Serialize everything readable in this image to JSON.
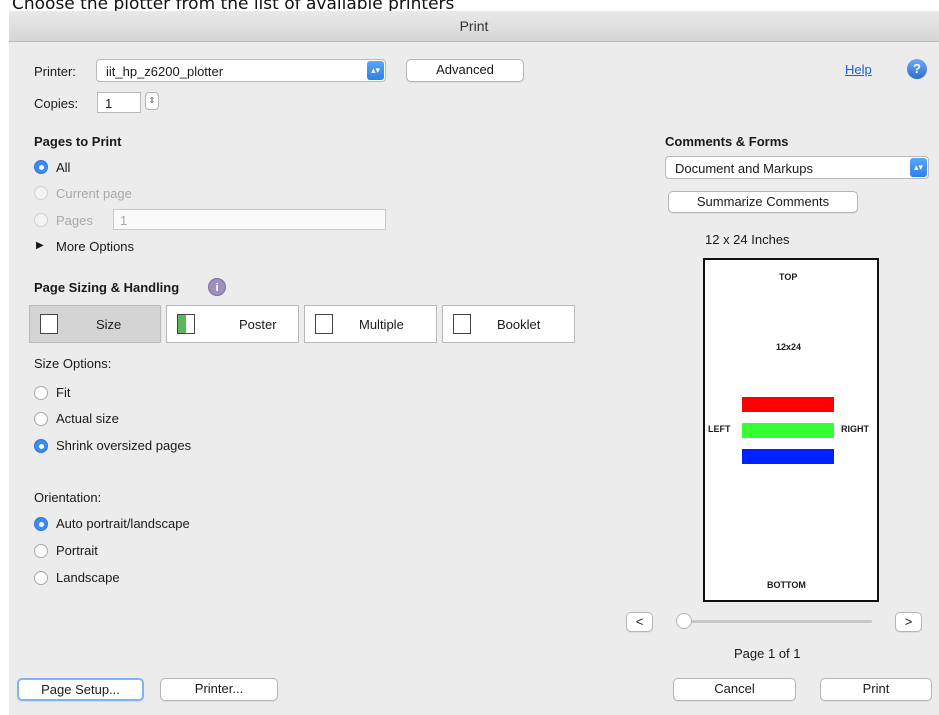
{
  "caption": "Choose the plotter from the list of available printers",
  "window_title": "Print",
  "printer": {
    "label": "Printer:",
    "value": "iit_hp_z6200_plotter",
    "advanced_label": "Advanced"
  },
  "help_label": "Help",
  "copies": {
    "label": "Copies:",
    "value": "1"
  },
  "pages_to_print": {
    "heading": "Pages to Print",
    "all_label": "All",
    "current_label": "Current page",
    "pages_label": "Pages",
    "pages_value": "1",
    "more_options_label": "More Options",
    "selected": "All"
  },
  "page_sizing": {
    "heading": "Page Sizing & Handling",
    "buttons": [
      "Size",
      "Poster",
      "Multiple",
      "Booklet"
    ],
    "selected": "Size"
  },
  "size_options": {
    "heading": "Size Options:",
    "options": [
      "Fit",
      "Actual size",
      "Shrink oversized pages"
    ],
    "selected": "Shrink oversized pages"
  },
  "orientation": {
    "heading": "Orientation:",
    "options": [
      "Auto portrait/landscape",
      "Portrait",
      "Landscape"
    ],
    "selected": "Auto portrait/landscape"
  },
  "comments_forms": {
    "heading": "Comments & Forms",
    "value": "Document and Markups",
    "summarize_label": "Summarize Comments"
  },
  "preview": {
    "size_label": "12 x 24 Inches",
    "top": "TOP",
    "center": "12x24",
    "left": "LEFT",
    "right": "RIGHT",
    "bottom": "BOTTOM",
    "bar_colors": [
      "#ff0000",
      "#33ff33",
      "#0022ff"
    ],
    "prev_label": "<",
    "next_label": ">",
    "page_label": "Page 1 of 1",
    "slider_position": 0
  },
  "footer": {
    "page_setup_label": "Page Setup...",
    "printer_label": "Printer...",
    "cancel_label": "Cancel",
    "print_label": "Print"
  }
}
